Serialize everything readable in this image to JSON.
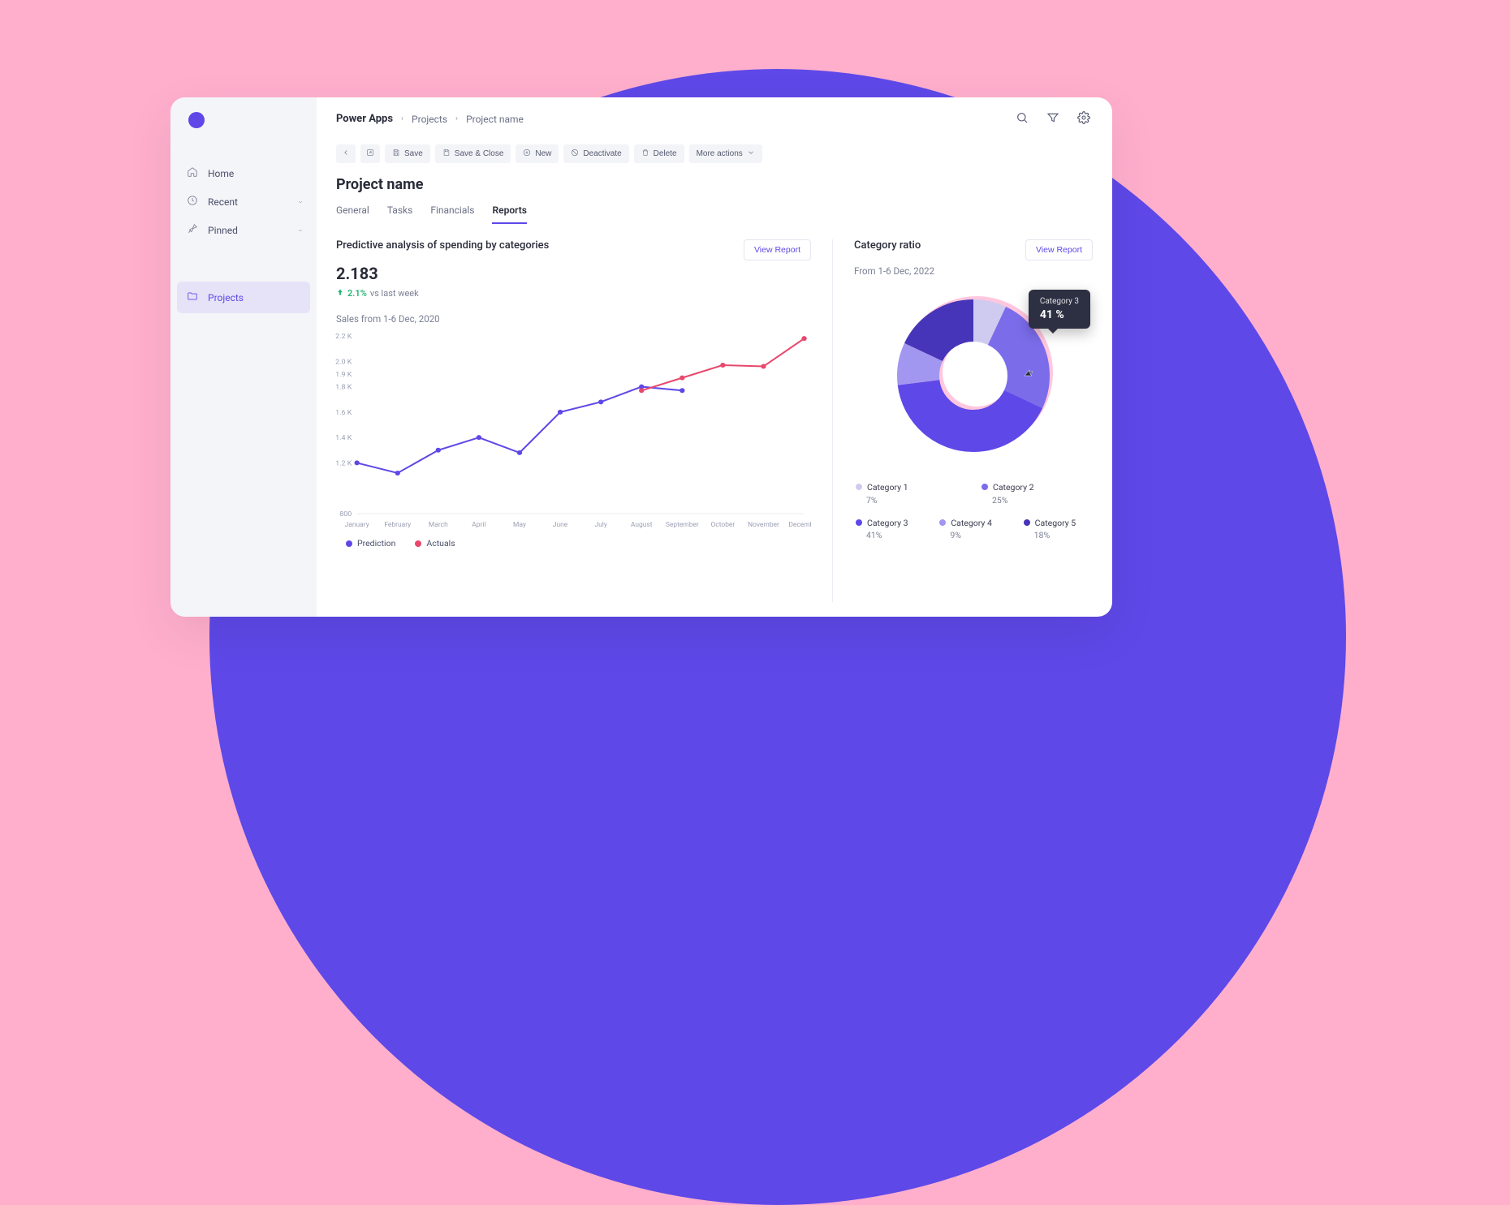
{
  "breadcrumb": {
    "brand": "Power Apps",
    "level1": "Projects",
    "level2": "Project name"
  },
  "sidebar": {
    "items": [
      {
        "label": "Home"
      },
      {
        "label": "Recent"
      },
      {
        "label": "Pinned"
      },
      {
        "label": "Projects"
      }
    ]
  },
  "toolbar": {
    "save": "Save",
    "save_close": "Save & Close",
    "new": "New",
    "deactivate": "Deactivate",
    "delete": "Delete",
    "more": "More actions"
  },
  "page": {
    "title": "Project name"
  },
  "tabs": [
    {
      "label": "General"
    },
    {
      "label": "Tasks"
    },
    {
      "label": "Financials"
    },
    {
      "label": "Reports"
    }
  ],
  "left_panel": {
    "title": "Predictive analysis of spending by categories",
    "big_num": "2.183",
    "trend_pct": "2.1%",
    "trend_rest": "vs last week",
    "sales_sub": "Sales from 1-6 Dec, 2020",
    "legend": {
      "prediction": "Prediction",
      "actuals": "Actuals"
    },
    "view_report": "View Report"
  },
  "right_panel": {
    "title": "Category ratio",
    "subdate": "From 1-6 Dec, 2022",
    "view_report": "View Report",
    "tooltip": {
      "category": "Category 3",
      "value": "41 %"
    }
  },
  "chart_data": [
    {
      "type": "line",
      "title": "Predictive analysis of spending by categories",
      "xlabel": "",
      "ylabel": "",
      "ylim": [
        800,
        2200
      ],
      "y_ticks": [
        "2.2 K",
        "2.0 K",
        "1.9 K",
        "1.8 K",
        "1.6 K",
        "1.4 K",
        "1.2 K",
        "800"
      ],
      "y_tick_values": [
        2200,
        2000,
        1900,
        1800,
        1600,
        1400,
        1200,
        800
      ],
      "categories": [
        "January",
        "February",
        "March",
        "April",
        "May",
        "June",
        "July",
        "August",
        "September",
        "October",
        "November",
        "December"
      ],
      "series": [
        {
          "name": "Prediction",
          "color": "#5E48E8",
          "values": [
            1200,
            1120,
            1300,
            1400,
            1280,
            1600,
            1680,
            1800,
            1770,
            null,
            null,
            null
          ]
        },
        {
          "name": "Actuals",
          "color": "#E8486C",
          "values": [
            null,
            null,
            null,
            null,
            null,
            null,
            null,
            1770,
            1870,
            1970,
            1960,
            2180
          ]
        }
      ]
    },
    {
      "type": "pie",
      "title": "Category ratio",
      "series": [
        {
          "name": "Category 1",
          "value": 7,
          "color": "#CFCBF0"
        },
        {
          "name": "Category 2",
          "value": 25,
          "color": "#7B6CEA"
        },
        {
          "name": "Category 3",
          "value": 41,
          "color": "#5E48E8"
        },
        {
          "name": "Category 4",
          "value": 9,
          "color": "#A297F0"
        },
        {
          "name": "Category 5",
          "value": 18,
          "color": "#4635B8"
        }
      ]
    }
  ]
}
